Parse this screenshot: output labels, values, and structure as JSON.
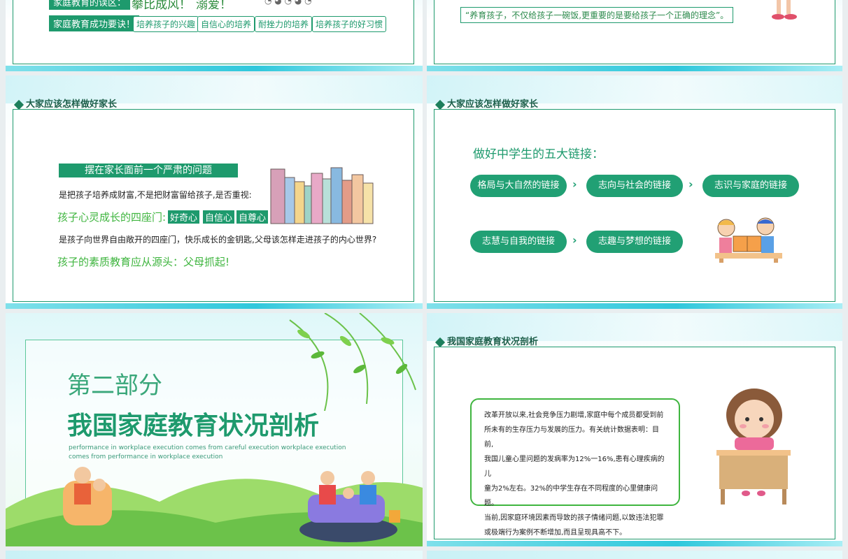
{
  "slide1": {
    "partial_top_left": "家庭教育的误区：",
    "partial_top_mid": "攀比成风！",
    "partial_top_right": "溺爱！",
    "key_label": "家庭教育成功要诀！",
    "keys": [
      "培养孩子的兴趣",
      "自信心的培养",
      "耐挫力的培养",
      "培养孩子的好习惯"
    ]
  },
  "slide2": {
    "quote": "“养育孩子，不仅给孩子一碗饭,更重要的是要给孩子一个正确的理念”。"
  },
  "slide3": {
    "header": "大家应该怎样做好家长",
    "banner": "摆在家长面前一个严肃的问题",
    "line1": "是把孩子培养成财富,不是把财富留给孩子,是否重视:",
    "doors_label": "孩子心灵成长的四座门:",
    "doors": [
      "好奇心",
      "自信心",
      "自尊心"
    ],
    "line2": "是孩子向世界自由敞开的四座门，快乐成长的金钥匙,父母该怎样走进孩子的内心世界?",
    "line3": "孩子的素质教育应从源头：父母抓起!"
  },
  "slide4": {
    "header": "大家应该怎样做好家长",
    "title": "做好中学生的五大链接：",
    "links": [
      "格局与大自然的链接",
      "志向与社会的链接",
      "志识与家庭的链接",
      "志慧与自我的链接",
      "志趣与梦想的链接"
    ]
  },
  "slide5": {
    "part": "第二部分",
    "title": "我国家庭教育状况剖析",
    "subtitle1": "performance in workplace execution comes from careful execution workplace execution",
    "subtitle2": "comes from performance in workplace execution"
  },
  "slide6": {
    "header": "我国家庭教育状况剖析",
    "paragraph_lines": [
      "改革开放以来,社会竞争压力剧增,家庭中每个成员都受到前",
      "所未有的生存压力与发展的压力。有关统计数据表明：目前,",
      "我国儿童心里问题的发病率为12%一16%,患有心理疾病的儿",
      "童为2%左右。32%的中学生存在不同程度的心里健康问题。",
      "当前,因家庭环境因素而导致的孩子情绪问题,以致违法犯罪",
      "或极端行为案例不断增加,而且呈现具高不下。"
    ]
  },
  "colors": {
    "primary_green": "#1e9a6d",
    "accent_teal": "#2fc8dc",
    "light_green": "#3fb53f"
  }
}
